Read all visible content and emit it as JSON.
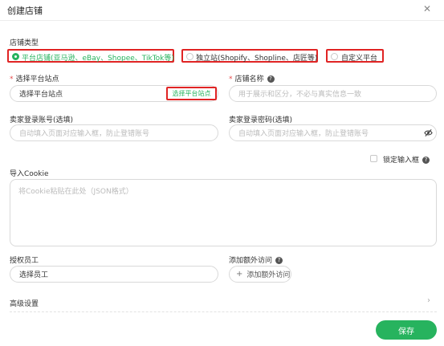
{
  "dialog": {
    "title": "创建店铺",
    "close_icon": "close-icon"
  },
  "store_type": {
    "label": "店铺类型",
    "options": [
      {
        "label": "平台店铺(亚马逊、eBay、Shopee、TikTok等)",
        "selected": true
      },
      {
        "label": "独立站(Shopify、Shopline、店匠等)",
        "selected": false
      },
      {
        "label": "自定义平台",
        "selected": false
      }
    ]
  },
  "platform_site": {
    "label": "选择平台站点",
    "value": "选择平台站点",
    "action": "选择平台站点"
  },
  "store_name": {
    "label": "店铺名称",
    "placeholder": "用于展示和区分，不必与真实信息一致"
  },
  "seller_account": {
    "label": "卖家登录账号(选填)",
    "placeholder": "自动填入页面对应输入框，防止登错账号"
  },
  "seller_password": {
    "label": "卖家登录密码(选填)",
    "placeholder": "自动填入页面对应输入框，防止登错账号",
    "icon": "eye-off-icon"
  },
  "lock_input": {
    "label": "锁定输入框"
  },
  "cookie": {
    "label": "导入Cookie",
    "placeholder": "将Cookie粘贴在此处（JSON格式）"
  },
  "staff": {
    "label": "授权员工",
    "value": "选择员工"
  },
  "extra_access": {
    "label": "添加额外访问",
    "button": "添加额外访问"
  },
  "advanced": {
    "label": "高级设置"
  },
  "footer": {
    "save": "保存"
  },
  "colors": {
    "accent": "#27b35e",
    "highlight": "#e02424"
  }
}
